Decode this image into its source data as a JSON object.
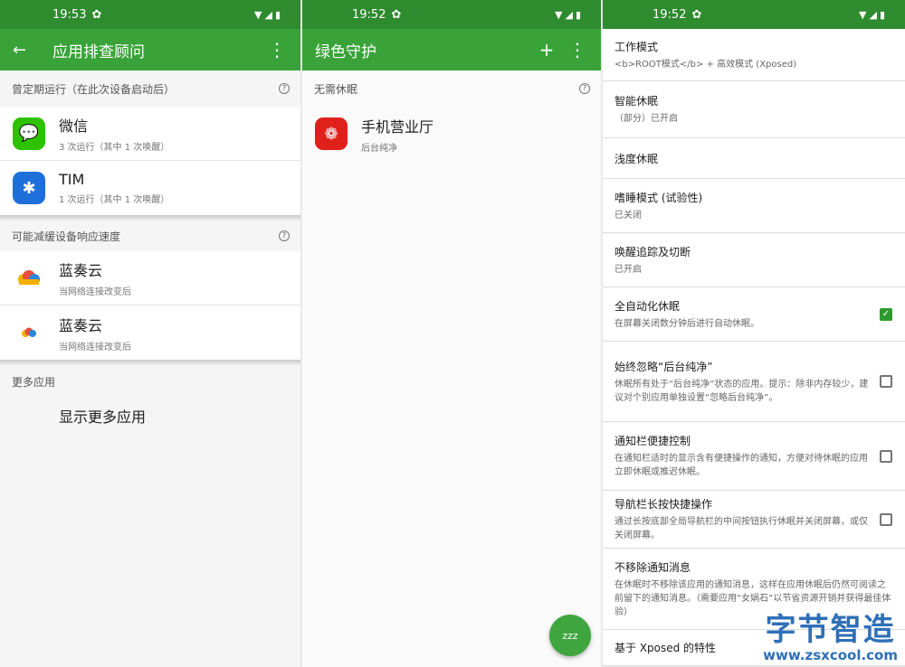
{
  "panel1": {
    "status_time": "19:53",
    "title": "应用排查顾问",
    "sections": [
      {
        "header": "曾定期运行（在此次设备启动后）",
        "apps": [
          {
            "name": "微信",
            "sub": "3 次运行（其中 1 次唤醒）",
            "icon": "wechat-icon",
            "color": "#2dc100"
          },
          {
            "name": "TIM",
            "sub": "1 次运行（其中 1 次唤醒）",
            "icon": "tim-icon",
            "color": "#1e6fd9"
          }
        ]
      },
      {
        "header": "可能减缓设备响应速度",
        "apps": [
          {
            "name": "蓝奏云",
            "sub": "当网络连接改变后",
            "icon": "lanzou-cloud-icon"
          },
          {
            "name": "蓝奏云",
            "sub": "当网络连接改变后",
            "icon": "lanzou-cloud-small-icon"
          }
        ]
      },
      {
        "header": "更多应用",
        "link": "显示更多应用"
      }
    ]
  },
  "panel2": {
    "status_time": "19:52",
    "title": "绿色守护",
    "section_header": "无需休眠",
    "app": {
      "name": "手机营业厅",
      "sub": "后台纯净",
      "icon": "china-unicom-icon",
      "color": "#e0201b"
    },
    "fab_label": "zzz"
  },
  "panel3": {
    "status_time": "19:52",
    "prefs": [
      {
        "title": "工作模式",
        "summary": "<b>ROOT模式</b> + 高效模式 (Xposed)"
      },
      {
        "title": "智能休眠",
        "summary": "（部分）已开启"
      },
      {
        "title": "浅度休眠",
        "summary": ""
      },
      {
        "title": "嗜睡模式 (试验性)",
        "summary": "已关闭"
      },
      {
        "title": "唤醒追踪及切断",
        "summary": "已开启"
      },
      {
        "title": "全自动化休眠",
        "summary": "在屏幕关闭数分钟后进行自动休眠。",
        "checked": true
      },
      {
        "title": "始终忽略“后台纯净”",
        "summary": "休眠所有处于“后台纯净”状态的应用。提示：除非内存较少，建议对个别应用单独设置“忽略后台纯净”。",
        "checked": false
      },
      {
        "title": "通知栏便捷控制",
        "summary": "在通知栏适时的显示含有便捷操作的通知，方便对待休眠的应用立即休眠或推迟休眠。",
        "checked": false
      },
      {
        "title": "导航栏长按快捷操作",
        "summary": "通过长按底部全局导航栏的中间按钮执行休眠并关闭屏幕，或仅关闭屏幕。",
        "checked": false
      },
      {
        "title": "不移除通知消息",
        "summary": "在休眠时不移除该应用的通知消息，这样在应用休眠后仍然可阅读之前留下的通知消息。（需要应用“女娲石”以节省资源开销并获得最佳体验）"
      },
      {
        "title": "基于 Xposed 的特性",
        "summary": ""
      }
    ]
  },
  "watermark": {
    "big": "字节智造",
    "small": "www.zsxcool.com"
  },
  "accent": "#39a339",
  "statusbar_color": "#2e8b2e"
}
